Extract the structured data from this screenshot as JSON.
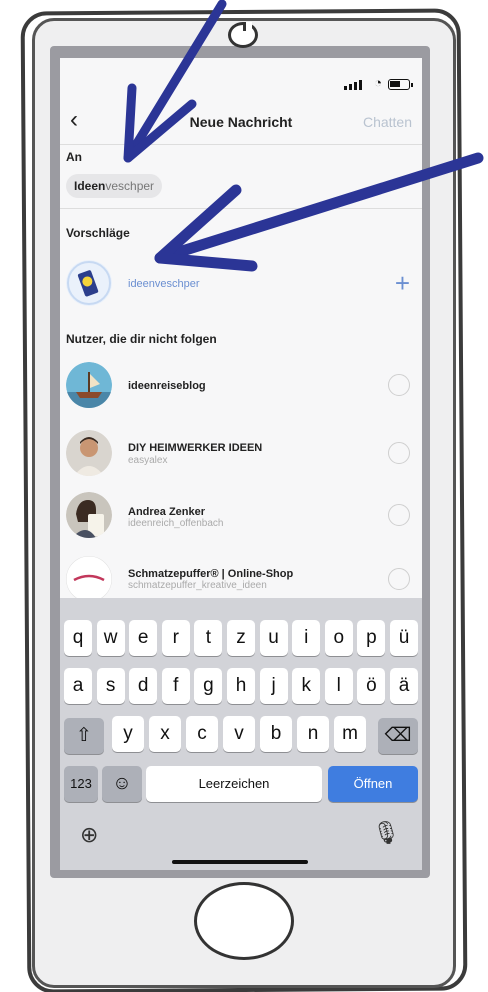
{
  "navbar": {
    "back_icon": "chevron-left-icon",
    "title": "Neue Nachricht",
    "chat_label": "Chatten"
  },
  "recipient": {
    "label": "An",
    "chip_bold": "Ideen",
    "chip_rest": "veschper"
  },
  "suggestions": {
    "header": "Vorschläge",
    "item": {
      "name": "ideenveschper",
      "action_icon": "plus-icon"
    }
  },
  "non_followers": {
    "header": "Nutzer, die dir nicht folgen",
    "items": [
      {
        "name": "ideenreiseblog",
        "handle": ""
      },
      {
        "name": "DIY HEIMWERKER IDEEN",
        "handle": "easyalex"
      },
      {
        "name": "Andrea Zenker",
        "handle": "ideenreich_offenbach"
      },
      {
        "name": "Schmatzepuffer® | Online-Shop",
        "handle": "schmatzepuffer_kreative_ideen"
      }
    ]
  },
  "keyboard": {
    "row1": [
      "q",
      "w",
      "e",
      "r",
      "t",
      "z",
      "u",
      "i",
      "o",
      "p",
      "ü"
    ],
    "row2": [
      "a",
      "s",
      "d",
      "f",
      "g",
      "h",
      "j",
      "k",
      "l",
      "ö",
      "ä"
    ],
    "row3": [
      "y",
      "x",
      "c",
      "v",
      "b",
      "n",
      "m"
    ],
    "numbers_label": "123",
    "space_label": "Leerzeichen",
    "open_label": "Öffnen"
  },
  "colors": {
    "accent": "#3f7de0",
    "arrow": "#2b3596"
  }
}
